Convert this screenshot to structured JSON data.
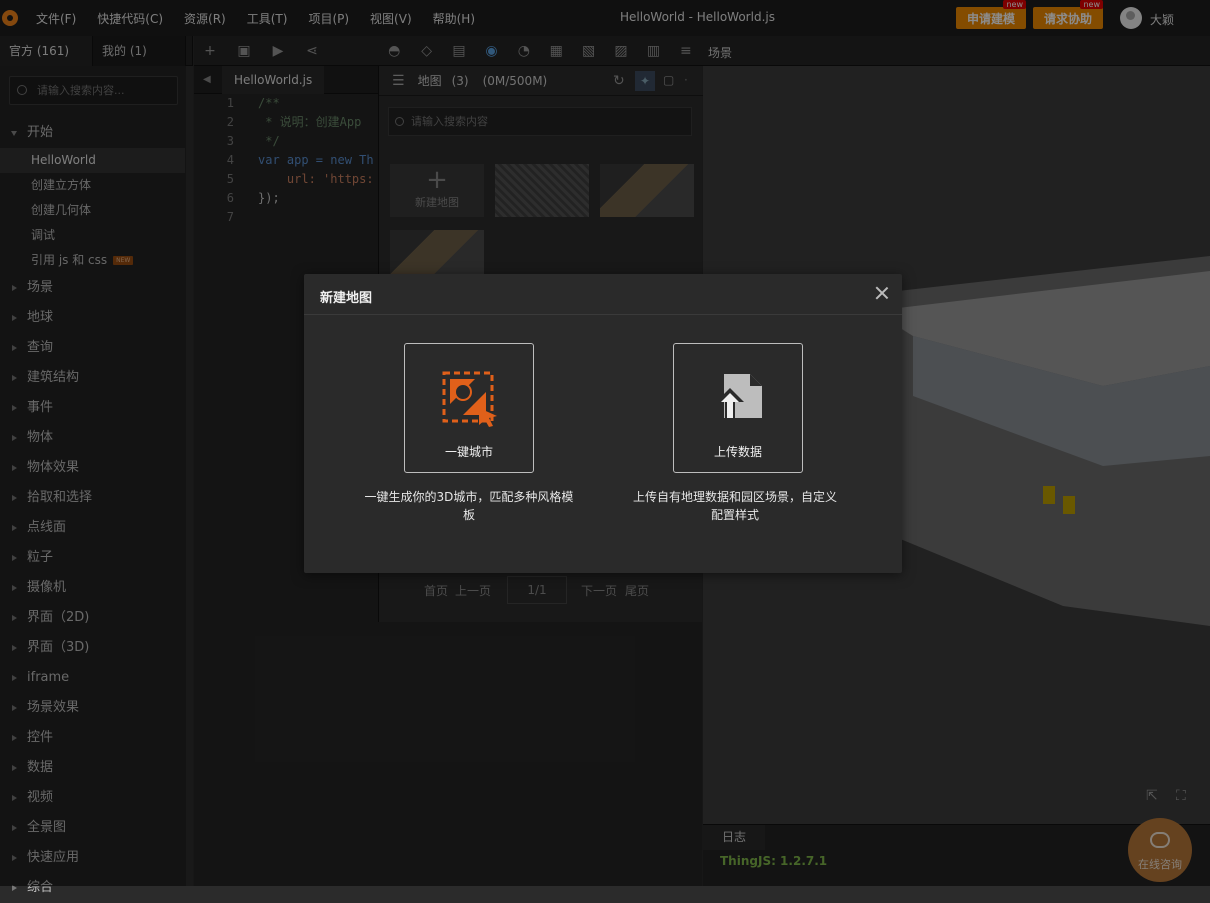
{
  "menubar": {
    "items": [
      "文件(F)",
      "快捷代码(C)",
      "资源(R)",
      "工具(T)",
      "项目(P)",
      "视图(V)",
      "帮助(H)"
    ],
    "title": "HelloWorld -  HelloWorld.js",
    "apply_model_btn": "申请建模",
    "request_help_btn": "请求协助",
    "new_badge": "new",
    "username": "大颖",
    "accent_color": "#f08a00"
  },
  "sidebar": {
    "tabs": [
      "官方 (161)",
      "我的 (1)"
    ],
    "search_placeholder": "请输入搜索内容...",
    "open_category": "开始",
    "items": [
      "HelloWorld",
      "创建立方体",
      "创建几何体",
      "调试",
      "引用 js 和 css"
    ],
    "new_badge": "NEW",
    "categories": [
      "场景",
      "地球",
      "查询",
      "建筑结构",
      "事件",
      "物体",
      "物体效果",
      "拾取和选择",
      "点线面",
      "粒子",
      "摄像机",
      "界面（2D)",
      "界面（3D)",
      "iframe",
      "场景效果",
      "控件",
      "数据",
      "视频",
      "全景图",
      "快速应用",
      "综合"
    ]
  },
  "editor": {
    "tab": "HelloWorld.js",
    "lines": [
      {
        "n": "1",
        "text": "/**"
      },
      {
        "n": "2",
        "text": " * 说明：创建App"
      },
      {
        "n": "3",
        "text": " */"
      },
      {
        "n": "4",
        "text": "var app = new Th"
      },
      {
        "n": "5",
        "text": "    url: 'https:"
      },
      {
        "n": "6",
        "text": "});"
      },
      {
        "n": "7",
        "text": ""
      }
    ]
  },
  "map_panel": {
    "title": "地图",
    "count": "(3)",
    "storage": "(0M/500M)",
    "search_placeholder": "请输入搜索内容",
    "new_map": "新建地图",
    "pager": {
      "first": "首页",
      "prev": "上一页",
      "page": "1/1",
      "next": "下一页",
      "last": "尾页"
    }
  },
  "scene": {
    "tab": "场景",
    "log_tab": "日志",
    "log_text": "ThingJS: 1.2.7.1",
    "consult": "在线咨询"
  },
  "dialog": {
    "title": "新建地图",
    "option1": {
      "label": "一键城市",
      "desc": "一键生成你的3D城市，匹配多种风格模板",
      "icon": "city-map-icon",
      "color": "#e0601a"
    },
    "option2": {
      "label": "上传数据",
      "desc": "上传自有地理数据和园区场景，自定义配置样式",
      "icon": "upload-file-icon"
    }
  }
}
